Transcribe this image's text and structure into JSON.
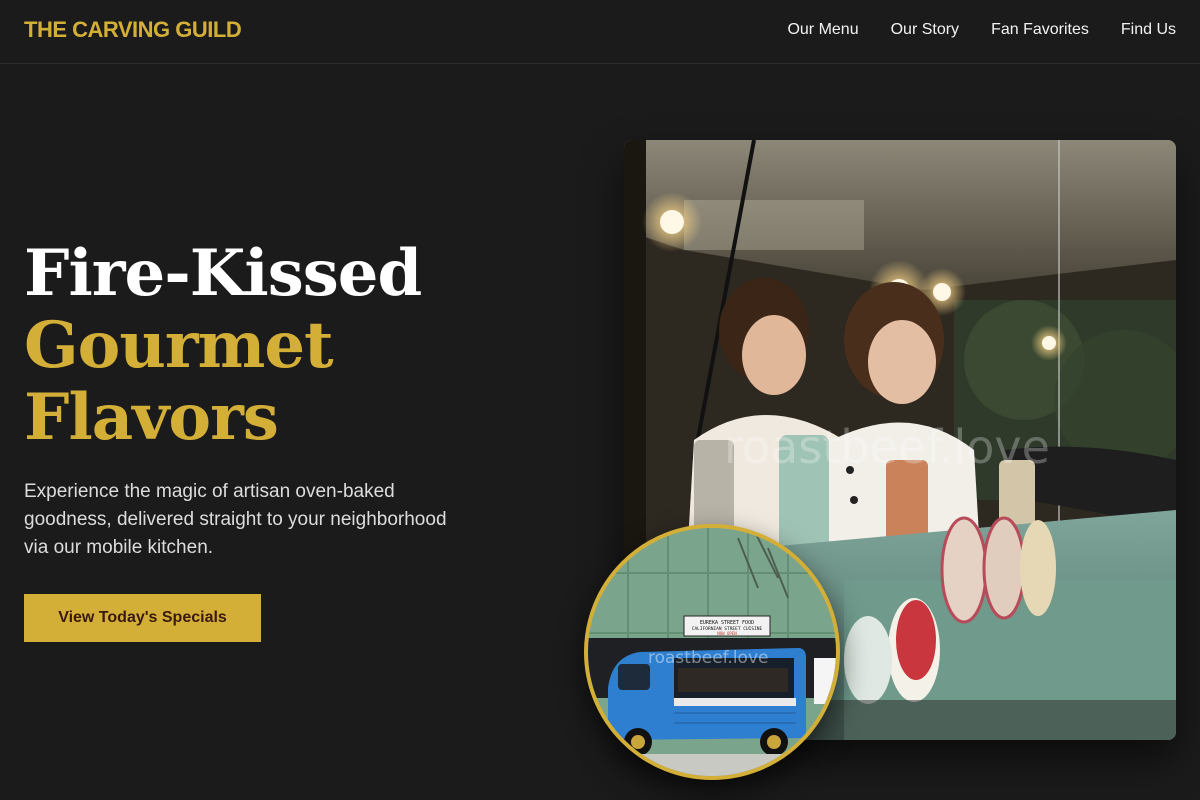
{
  "header": {
    "brand": "THE CARVING GUILD",
    "nav": [
      "Our Menu",
      "Our Story",
      "Fan Favorites",
      "Find Us"
    ]
  },
  "hero": {
    "title_line1": "Fire-Kissed",
    "title_line2": "Gourmet",
    "title_line3": "Flavors",
    "description": "Experience the magic of artisan oven-baked goodness, delivered straight to your neighborhood via our mobile kitchen.",
    "cta_label": "View Today's Specials"
  },
  "images": {
    "main_watermark": "roastbeef.love",
    "inset_watermark": "roastbeef.love",
    "inset_sign_line1": "EUREKA STREET FOOD",
    "inset_sign_line2": "CALIFORNIAN STREET CUISINE",
    "inset_sign_line3": "NOW OPEN"
  },
  "colors": {
    "background": "#1b1b1b",
    "accent_gold": "#d4af37",
    "cta_text": "#3a1a10"
  }
}
